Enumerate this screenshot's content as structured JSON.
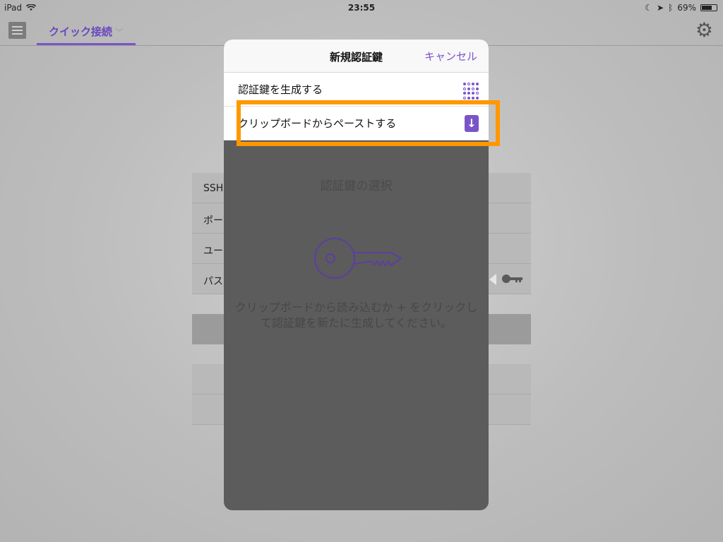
{
  "status_bar": {
    "device": "iPad",
    "time": "23:55",
    "battery": "69%",
    "battery_level": 0.69
  },
  "nav": {
    "tab_label": "クイック接続",
    "menu_icon": "list-icon",
    "settings_icon": "gear-icon"
  },
  "background_form": {
    "rows": [
      "SSH",
      "ポー",
      "ユー",
      "パス"
    ]
  },
  "popover": {
    "title": "新規認証鍵",
    "cancel_label": "キャンセル",
    "menu": [
      {
        "label": "認証鍵を生成する",
        "icon": "generate-key-icon"
      },
      {
        "label": "クリップボードからペーストする",
        "icon": "paste-icon"
      }
    ],
    "empty_state": {
      "title": "認証鍵の選択",
      "message": "クリップボードから読み込むか + をクリックして認証鍵を新たに生成してください。",
      "icon": "key-icon"
    }
  },
  "colors": {
    "accent": "#7a55c8",
    "highlight": "#ff9800",
    "overlay": "#5c5c5c"
  }
}
